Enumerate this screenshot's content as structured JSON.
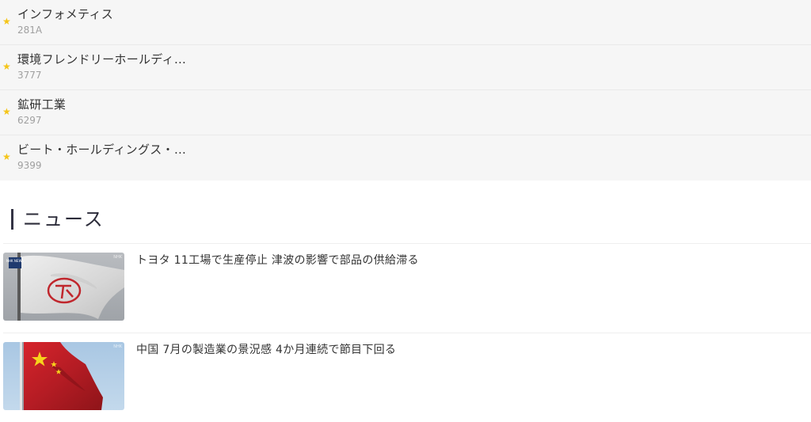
{
  "watchlist": {
    "items": [
      {
        "name": "インフォメティス",
        "code": "281A"
      },
      {
        "name": "環境フレンドリーホールディ…",
        "code": "3777"
      },
      {
        "name": "鉱研工業",
        "code": "6297"
      },
      {
        "name": "ビート・ホールディングス・…",
        "code": "9399"
      }
    ]
  },
  "news": {
    "heading": "ニュース",
    "items": [
      {
        "title": "トヨタ 11工場で生産停止 津波の影響で部品の供給滞る",
        "thumb_logo": "NHK NEWS",
        "thumb_watermark": "NHK",
        "thumb_icon": "flag-toyota-icon"
      },
      {
        "title": "中国 7月の製造業の景況感 4か月連続で節目下回る",
        "thumb_watermark": "NHK",
        "thumb_icon": "flag-china-icon"
      }
    ]
  },
  "colors": {
    "star": "#f5c518",
    "list_bg": "#f6f6f6",
    "code_text": "#a0a0a0",
    "heading_bar": "#333344"
  }
}
